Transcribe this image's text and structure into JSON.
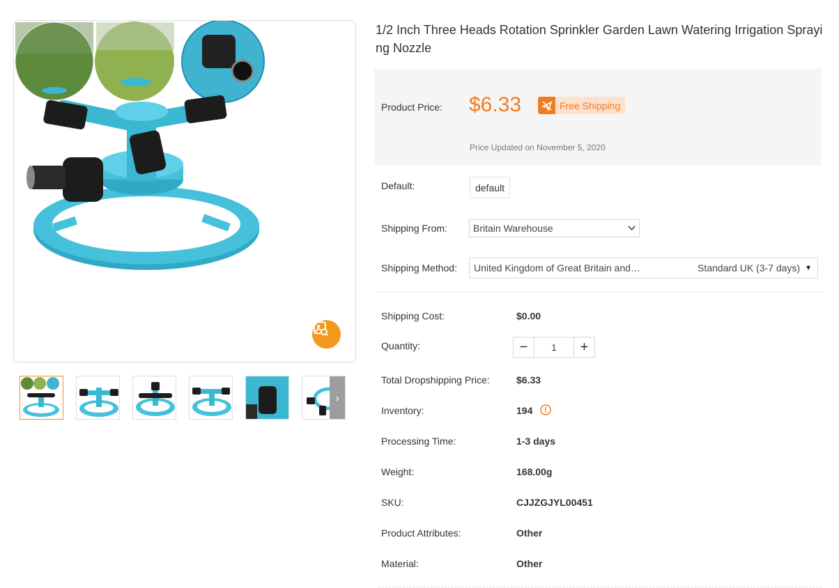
{
  "product": {
    "title": "1/2 Inch Three Heads Rotation Sprinkler Garden Lawn Watering Irrigation Spraying Nozzle",
    "price_label": "Product Price:",
    "price": "$6.33",
    "free_shipping": "Free Shipping",
    "price_updated": "Price Updated on November 5, 2020"
  },
  "options": {
    "default_label": "Default:",
    "default_value": "default",
    "shipping_from_label": "Shipping From:",
    "shipping_from_value": "Britain Warehouse",
    "shipping_method_label": "Shipping Method:",
    "shipping_method_country": "United Kingdom of Great Britain and…",
    "shipping_method_value": "Standard UK (3-7 days)"
  },
  "details": {
    "shipping_cost_label": "Shipping Cost:",
    "shipping_cost": "$0.00",
    "quantity_label": "Quantity:",
    "quantity": "1",
    "minus": "−",
    "plus": "+",
    "total_label": "Total Dropshipping Price:",
    "total": "$6.33",
    "inventory_label": "Inventory:",
    "inventory": "194",
    "processing_label": "Processing Time:",
    "processing": "1-3 days",
    "weight_label": "Weight:",
    "weight": "168.00g",
    "sku_label": "SKU:",
    "sku": "CJJZGJYL00451",
    "attributes_label": "Product Attributes:",
    "attributes": "Other",
    "material_label": "Material:",
    "material": "Other"
  },
  "colors": {
    "accent": "#f07c22",
    "sprinkler_blue": "#3ab7d1",
    "image_search": "#f39a1e"
  }
}
